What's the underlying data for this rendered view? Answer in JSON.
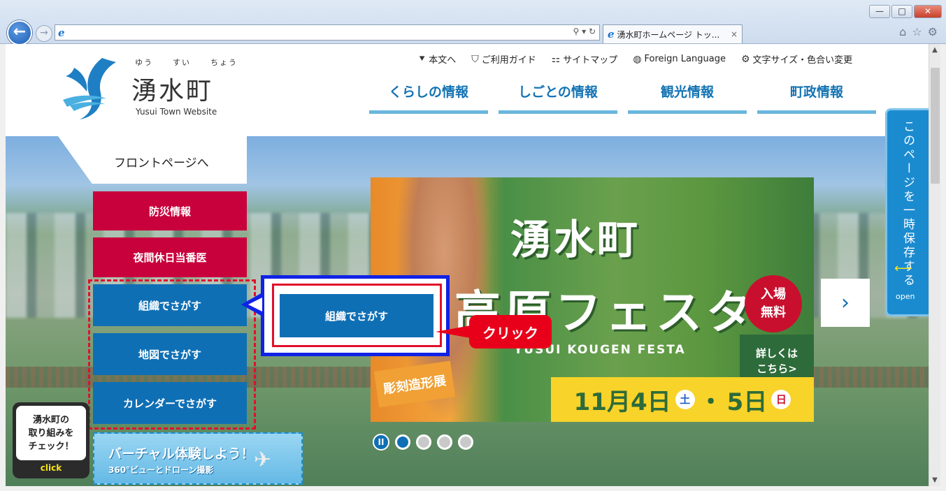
{
  "browser": {
    "tab_title": "湧水町ホームページ トッ...",
    "tab_close": "×",
    "win_min": "—",
    "win_max": "□",
    "win_close": "✕",
    "address_tools": "⚲ ▾ ↻"
  },
  "header": {
    "logo_ruby": [
      "ゆう",
      "すい",
      "ちょう"
    ],
    "logo_name": "湧水町",
    "logo_en": "Yusui Town Website"
  },
  "utility_nav": [
    {
      "icon": "down-arrow-icon",
      "glyph": "⯆",
      "label": "本文へ"
    },
    {
      "icon": "guide-icon",
      "glyph": "⛉",
      "label": "ご利用ガイド"
    },
    {
      "icon": "sitemap-icon",
      "glyph": "⚏",
      "label": "サイトマップ"
    },
    {
      "icon": "globe-icon",
      "glyph": "◍",
      "label": "Foreign Language"
    },
    {
      "icon": "settings-icon",
      "glyph": "⚙",
      "label": "文字サイズ・色合い変更"
    }
  ],
  "global_nav": [
    "くらしの情報",
    "しごとの情報",
    "観光情報",
    "町政情報"
  ],
  "hero": {
    "front_page_link": "フロントページへ",
    "menu": {
      "disaster": "防災情報",
      "night_doctor": "夜間休日当番医",
      "by_org": "組織でさがす",
      "by_map": "地図でさがす",
      "by_calendar": "カレンダーでさがす"
    },
    "popup_button": "組織でさがす",
    "click_callout": "クリック",
    "banner": {
      "title_line1": "湧水町",
      "title_line2": "高原フェスタ",
      "subtitle_en": "YUSUI KOUGEN FESTA",
      "badge": "入場\n無料",
      "badge_l1": "入場",
      "badge_l2": "無料",
      "detail_l1": "詳しくは",
      "detail_l2": "こちら>",
      "exhibition": "彫刻造形展",
      "date_part1": "11月4日",
      "dow1": "土",
      "date_sep": "・",
      "date_part2": "5日",
      "dow2": "日"
    },
    "next_arrow": "›",
    "pause_label": "II",
    "save_tab": {
      "text": "このページを一時保存する",
      "open_label": "open"
    },
    "check_box": {
      "line1": "湧水町の",
      "line2": "取り組みを",
      "line3": "チェック！",
      "click": "click"
    },
    "virtual": {
      "title": "バーチャル体験しよう！",
      "subtitle": "360°ビューとドローン撮影"
    }
  },
  "colors": {
    "brand_blue": "#0f6fb5",
    "disaster_red": "#c8003c",
    "callout_red": "#e8001a",
    "popup_blue": "#1022e6"
  }
}
